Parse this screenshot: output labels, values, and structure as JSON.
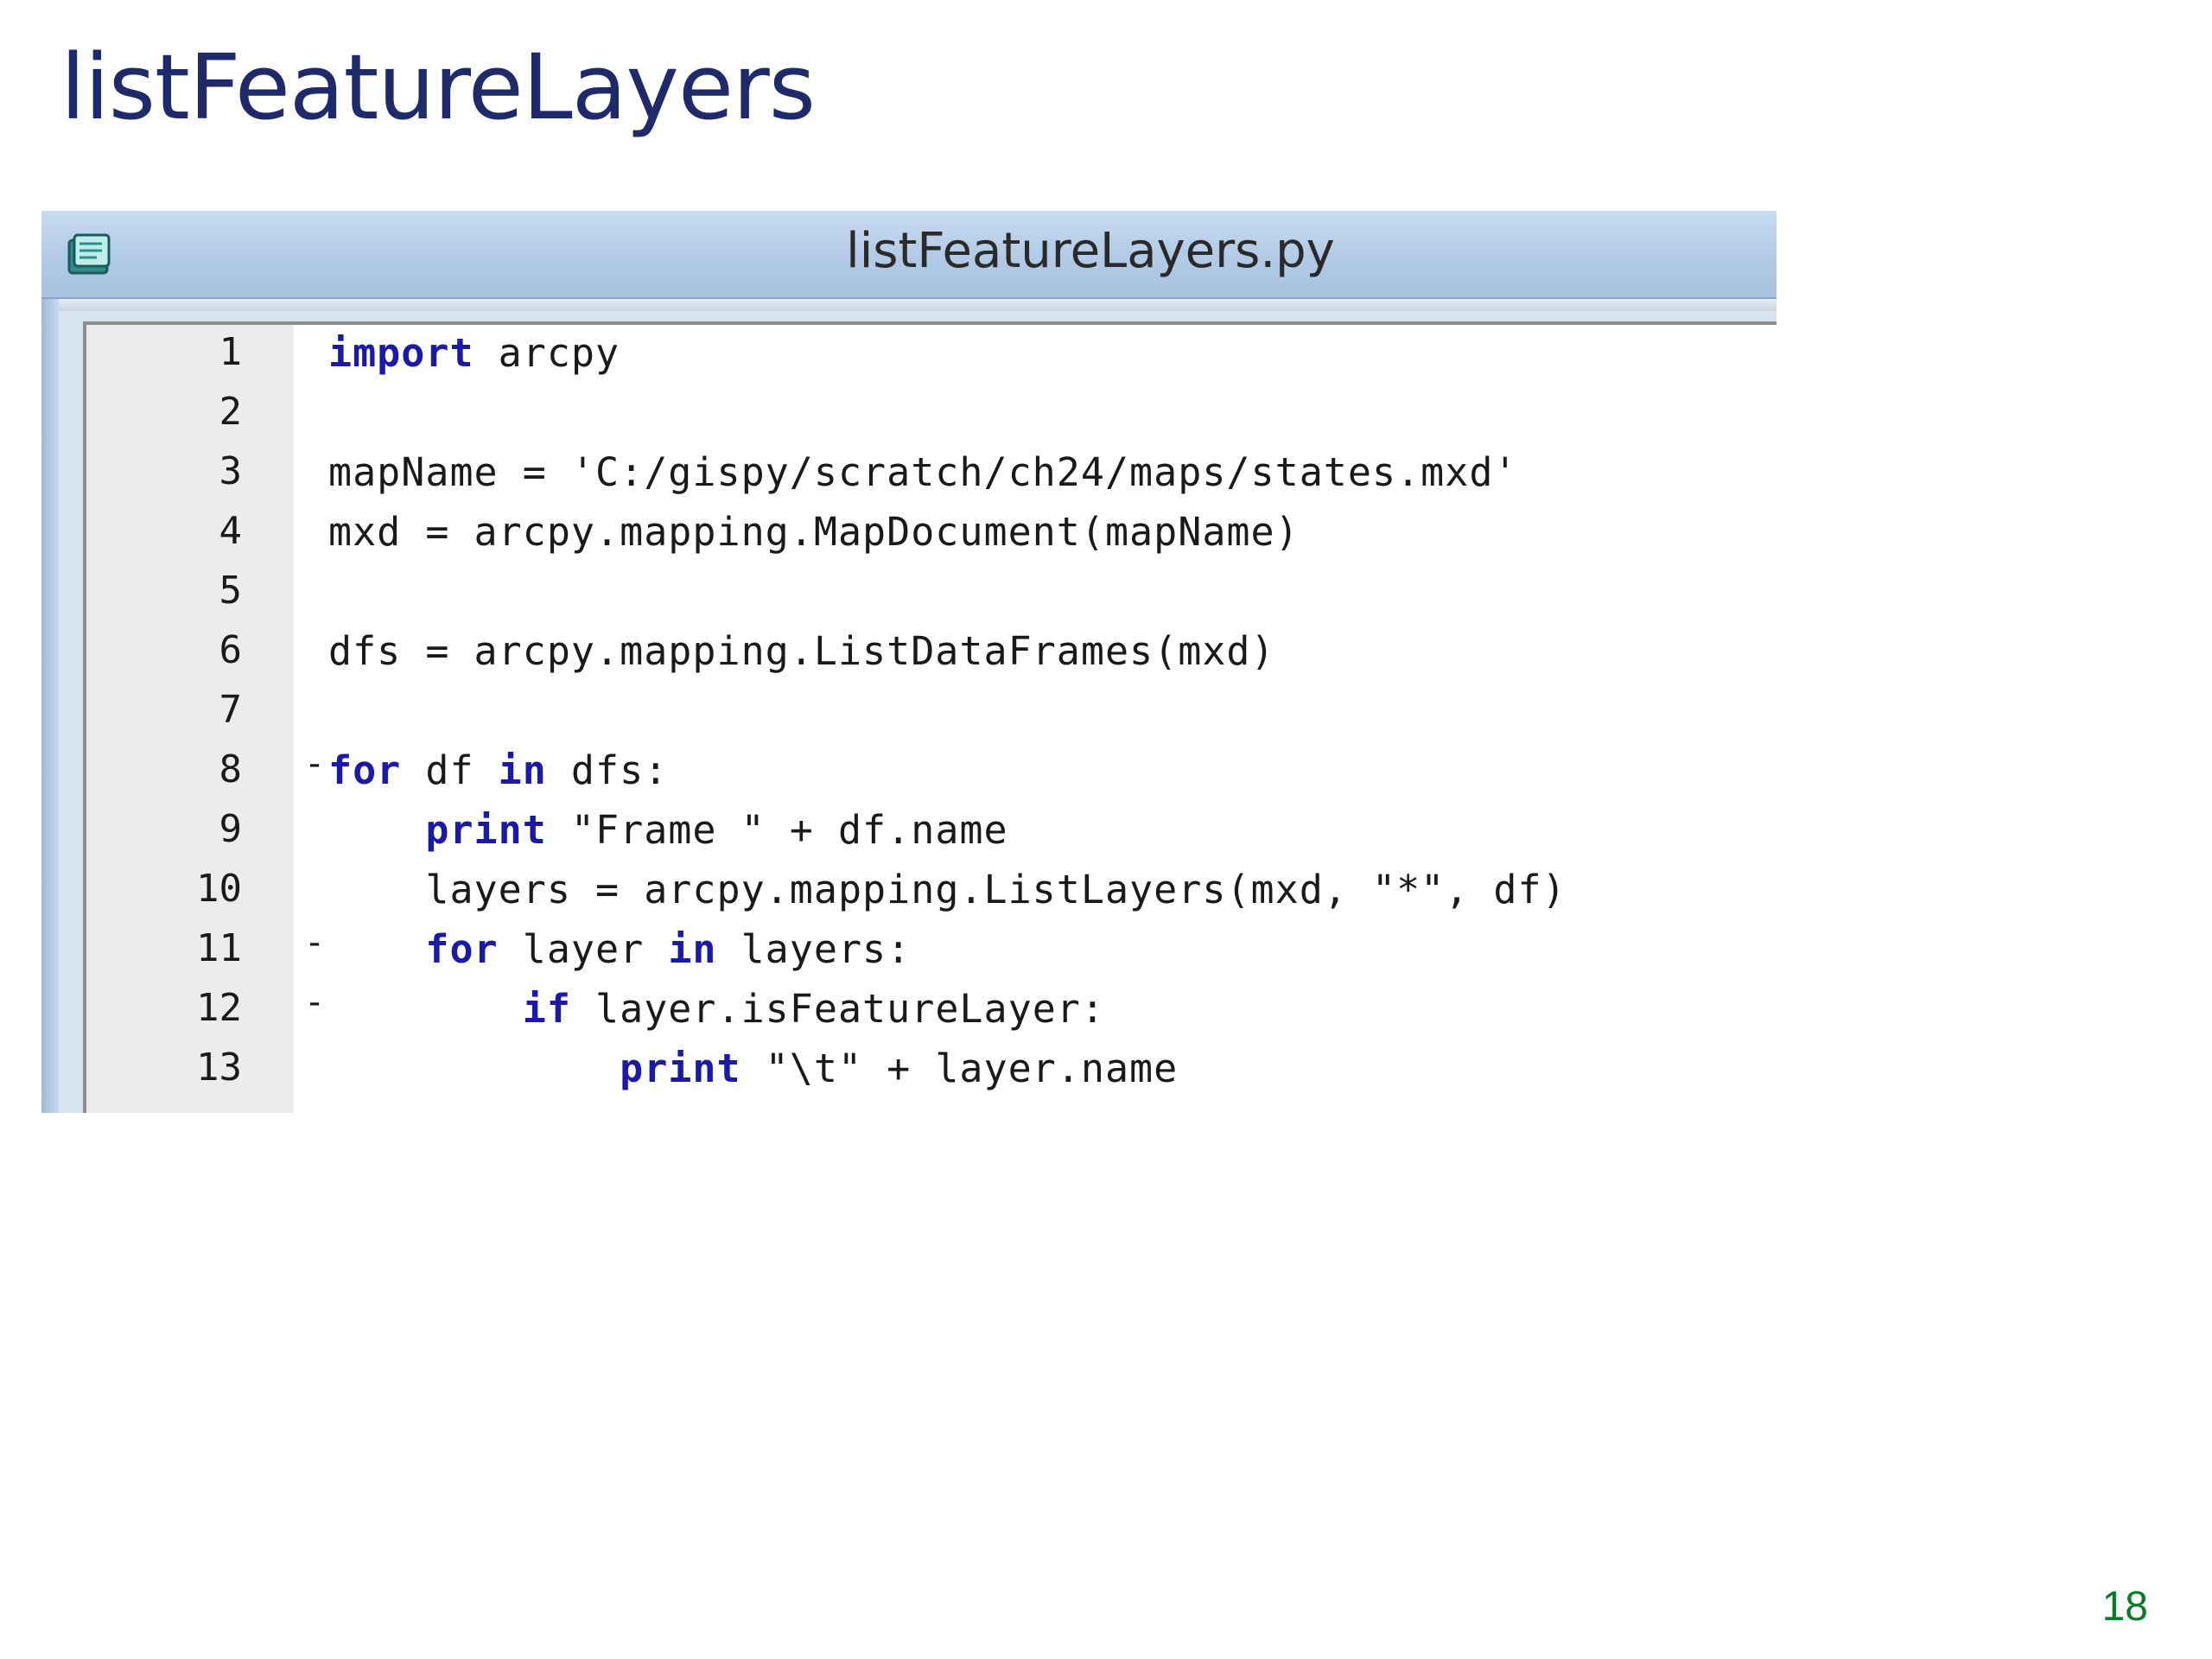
{
  "slide": {
    "title": "listFeatureLayers",
    "page_number": "18"
  },
  "window": {
    "title": "listFeatureLayers.py",
    "icon": "notebook-icon"
  },
  "code": {
    "lines": [
      {
        "number": "1",
        "fold": "",
        "indent": "",
        "tokens": [
          {
            "text": "import",
            "kw": true
          },
          {
            "text": " arcpy",
            "kw": false
          }
        ]
      },
      {
        "number": "2",
        "fold": "",
        "indent": "",
        "tokens": []
      },
      {
        "number": "3",
        "fold": "",
        "indent": "",
        "tokens": [
          {
            "text": "mapName = 'C:/gispy/scratch/ch24/maps/states.mxd'",
            "kw": false
          }
        ]
      },
      {
        "number": "4",
        "fold": "",
        "indent": "",
        "tokens": [
          {
            "text": "mxd = arcpy.mapping.MapDocument(mapName)",
            "kw": false
          }
        ]
      },
      {
        "number": "5",
        "fold": "",
        "indent": "",
        "tokens": []
      },
      {
        "number": "6",
        "fold": "",
        "indent": "",
        "tokens": [
          {
            "text": "dfs = arcpy.mapping.ListDataFrames(mxd)",
            "kw": false
          }
        ]
      },
      {
        "number": "7",
        "fold": "",
        "indent": "",
        "tokens": []
      },
      {
        "number": "8",
        "fold": "-",
        "indent": "",
        "tokens": [
          {
            "text": "for",
            "kw": true
          },
          {
            "text": " df ",
            "kw": false
          },
          {
            "text": "in",
            "kw": true
          },
          {
            "text": " dfs:",
            "kw": false
          }
        ]
      },
      {
        "number": "9",
        "fold": "",
        "indent": "    ",
        "tokens": [
          {
            "text": "print",
            "kw": true
          },
          {
            "text": " \"Frame \" + df.name",
            "kw": false
          }
        ]
      },
      {
        "number": "10",
        "fold": "",
        "indent": "    ",
        "tokens": [
          {
            "text": "layers = arcpy.mapping.ListLayers(mxd, \"*\", df)",
            "kw": false
          }
        ]
      },
      {
        "number": "11",
        "fold": "-",
        "indent": "    ",
        "tokens": [
          {
            "text": "for",
            "kw": true
          },
          {
            "text": " layer ",
            "kw": false
          },
          {
            "text": "in",
            "kw": true
          },
          {
            "text": " layers:",
            "kw": false
          }
        ]
      },
      {
        "number": "12",
        "fold": "-",
        "indent": "        ",
        "tokens": [
          {
            "text": "if",
            "kw": true
          },
          {
            "text": " layer.isFeatureLayer:",
            "kw": false
          }
        ]
      },
      {
        "number": "13",
        "fold": "",
        "indent": "            ",
        "tokens": [
          {
            "text": "print",
            "kw": true
          },
          {
            "text": " \"\\t\" + layer.name",
            "kw": false
          }
        ]
      }
    ]
  }
}
